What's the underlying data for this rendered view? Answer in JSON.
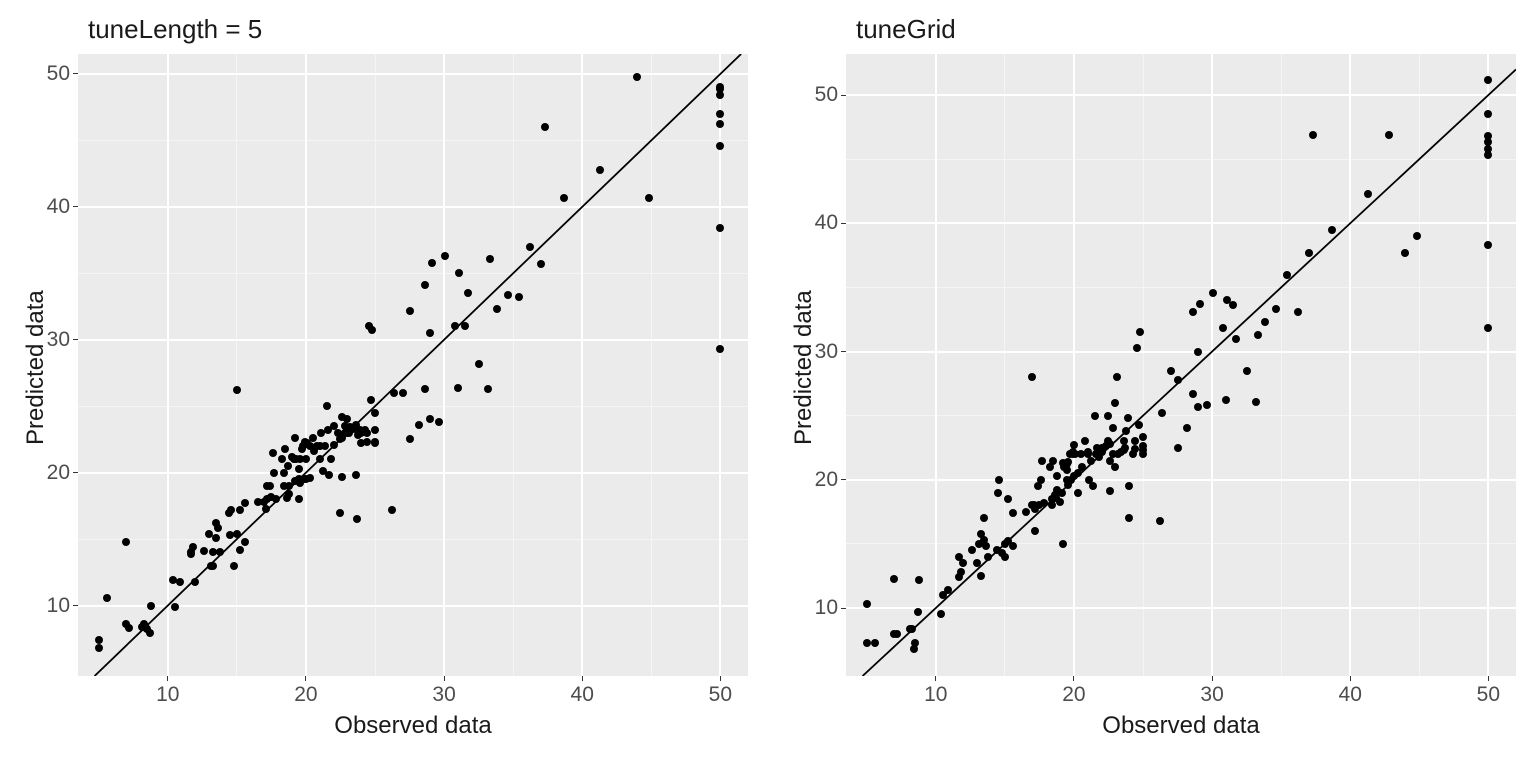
{
  "chart_data": [
    {
      "type": "scatter",
      "title": "tuneLength = 5",
      "xlabel": "Observed data",
      "ylabel": "Predicted data",
      "xlim": [
        3.5,
        52
      ],
      "ylim": [
        4.7,
        51.5
      ],
      "x_ticks": [
        10,
        20,
        30,
        40,
        50
      ],
      "y_ticks": [
        10,
        20,
        30,
        40,
        50
      ],
      "ref_line": {
        "slope": 1,
        "intercept": 0
      },
      "points": [
        [
          5.0,
          7.4
        ],
        [
          5.0,
          6.8
        ],
        [
          5.6,
          10.6
        ],
        [
          7.0,
          8.6
        ],
        [
          7.0,
          14.8
        ],
        [
          7.2,
          8.3
        ],
        [
          8.1,
          8.4
        ],
        [
          8.3,
          8.6
        ],
        [
          8.4,
          8.3
        ],
        [
          8.5,
          8.2
        ],
        [
          8.7,
          7.9
        ],
        [
          8.8,
          10.0
        ],
        [
          10.4,
          11.9
        ],
        [
          10.5,
          9.9
        ],
        [
          10.9,
          11.8
        ],
        [
          11.7,
          13.9
        ],
        [
          11.7,
          14.0
        ],
        [
          11.8,
          14.4
        ],
        [
          12.0,
          11.8
        ],
        [
          12.6,
          14.1
        ],
        [
          13.0,
          15.4
        ],
        [
          13.1,
          13.0
        ],
        [
          13.3,
          13.0
        ],
        [
          13.3,
          14.0
        ],
        [
          13.5,
          15.1
        ],
        [
          13.5,
          16.2
        ],
        [
          13.6,
          15.8
        ],
        [
          13.8,
          14.0
        ],
        [
          14.4,
          17.0
        ],
        [
          14.5,
          15.3
        ],
        [
          14.6,
          17.2
        ],
        [
          14.8,
          13.0
        ],
        [
          15.0,
          26.2
        ],
        [
          15.0,
          15.4
        ],
        [
          15.2,
          14.2
        ],
        [
          15.2,
          17.2
        ],
        [
          15.6,
          14.8
        ],
        [
          15.6,
          17.7
        ],
        [
          16.5,
          17.8
        ],
        [
          17.0,
          17.8
        ],
        [
          17.1,
          17.3
        ],
        [
          17.2,
          19.0
        ],
        [
          17.2,
          18.0
        ],
        [
          17.4,
          19.0
        ],
        [
          17.5,
          18.2
        ],
        [
          17.6,
          21.5
        ],
        [
          17.7,
          20.0
        ],
        [
          17.8,
          18.0
        ],
        [
          18.3,
          21.0
        ],
        [
          18.4,
          19.0
        ],
        [
          18.4,
          20.0
        ],
        [
          18.5,
          21.8
        ],
        [
          18.6,
          18.1
        ],
        [
          18.7,
          20.5
        ],
        [
          18.8,
          18.4
        ],
        [
          18.8,
          19.0
        ],
        [
          19.0,
          21.2
        ],
        [
          19.1,
          21.0
        ],
        [
          19.2,
          22.6
        ],
        [
          19.2,
          19.4
        ],
        [
          19.3,
          21.0
        ],
        [
          19.5,
          20.3
        ],
        [
          19.5,
          19.5
        ],
        [
          19.5,
          18.0
        ],
        [
          19.6,
          19.2
        ],
        [
          19.6,
          21.0
        ],
        [
          19.7,
          21.8
        ],
        [
          19.8,
          22.0
        ],
        [
          19.9,
          19.5
        ],
        [
          19.9,
          22.3
        ],
        [
          20.0,
          19.5
        ],
        [
          20.0,
          21.0
        ],
        [
          20.1,
          22.2
        ],
        [
          20.3,
          22.0
        ],
        [
          20.3,
          19.6
        ],
        [
          20.5,
          22.6
        ],
        [
          20.6,
          21.6
        ],
        [
          20.8,
          22.0
        ],
        [
          21.0,
          22.0
        ],
        [
          21.0,
          21.0
        ],
        [
          21.1,
          23.0
        ],
        [
          21.2,
          20.1
        ],
        [
          21.4,
          22.0
        ],
        [
          21.5,
          25.0
        ],
        [
          21.6,
          23.2
        ],
        [
          21.7,
          19.8
        ],
        [
          21.8,
          21.0
        ],
        [
          22.0,
          22.1
        ],
        [
          22.0,
          23.5
        ],
        [
          22.3,
          23.0
        ],
        [
          22.5,
          17.0
        ],
        [
          22.5,
          22.5
        ],
        [
          22.6,
          19.7
        ],
        [
          22.6,
          22.6
        ],
        [
          22.6,
          24.2
        ],
        [
          22.8,
          23.0
        ],
        [
          22.8,
          23.5
        ],
        [
          23.0,
          24.0
        ],
        [
          23.0,
          23.0
        ],
        [
          23.1,
          23.0
        ],
        [
          23.2,
          23.4
        ],
        [
          23.4,
          23.3
        ],
        [
          23.6,
          23.6
        ],
        [
          23.6,
          19.8
        ],
        [
          23.7,
          16.5
        ],
        [
          23.8,
          22.8
        ],
        [
          23.9,
          23.2
        ],
        [
          24.0,
          22.2
        ],
        [
          24.0,
          23.0
        ],
        [
          24.3,
          23.2
        ],
        [
          24.4,
          23.0
        ],
        [
          24.4,
          22.3
        ],
        [
          24.6,
          31.0
        ],
        [
          24.7,
          25.5
        ],
        [
          24.8,
          30.7
        ],
        [
          25.0,
          23.2
        ],
        [
          25.0,
          22.2
        ],
        [
          25.0,
          22.3
        ],
        [
          25.0,
          24.5
        ],
        [
          26.2,
          17.2
        ],
        [
          26.4,
          26.0
        ],
        [
          27.0,
          26.0
        ],
        [
          27.5,
          32.2
        ],
        [
          27.5,
          22.5
        ],
        [
          28.2,
          23.6
        ],
        [
          28.6,
          26.3
        ],
        [
          28.6,
          34.1
        ],
        [
          29.0,
          24.0
        ],
        [
          29.0,
          30.5
        ],
        [
          29.1,
          35.8
        ],
        [
          29.6,
          23.8
        ],
        [
          30.1,
          36.3
        ],
        [
          30.8,
          31.0
        ],
        [
          31.0,
          26.4
        ],
        [
          31.1,
          35.0
        ],
        [
          31.5,
          31.0
        ],
        [
          31.7,
          33.5
        ],
        [
          32.5,
          28.2
        ],
        [
          33.2,
          26.3
        ],
        [
          33.3,
          36.1
        ],
        [
          33.8,
          32.3
        ],
        [
          34.6,
          33.4
        ],
        [
          35.4,
          33.2
        ],
        [
          36.2,
          37.0
        ],
        [
          37.0,
          35.7
        ],
        [
          37.3,
          46.0
        ],
        [
          38.7,
          40.7
        ],
        [
          41.3,
          42.8
        ],
        [
          44.0,
          49.8
        ],
        [
          44.8,
          40.7
        ],
        [
          50.0,
          47.0
        ],
        [
          50.0,
          38.4
        ],
        [
          50.0,
          46.2
        ],
        [
          50.0,
          48.4
        ],
        [
          50.0,
          49.0
        ],
        [
          50.0,
          48.9
        ],
        [
          50.0,
          29.3
        ],
        [
          50.0,
          44.6
        ]
      ]
    },
    {
      "type": "scatter",
      "title": "tuneGrid",
      "xlabel": "Observed data",
      "ylabel": "Predicted data",
      "xlim": [
        3.5,
        52
      ],
      "ylim": [
        4.7,
        53.2
      ],
      "x_ticks": [
        10,
        20,
        30,
        40,
        50
      ],
      "y_ticks": [
        10,
        20,
        30,
        40,
        50
      ],
      "ref_line": {
        "slope": 1,
        "intercept": 0
      },
      "points": [
        [
          5.0,
          10.3
        ],
        [
          5.0,
          7.3
        ],
        [
          5.6,
          7.3
        ],
        [
          7.0,
          12.3
        ],
        [
          7.0,
          8.0
        ],
        [
          7.2,
          8.0
        ],
        [
          8.1,
          8.4
        ],
        [
          8.3,
          8.4
        ],
        [
          8.4,
          6.8
        ],
        [
          8.5,
          7.3
        ],
        [
          8.7,
          9.7
        ],
        [
          8.8,
          12.2
        ],
        [
          10.4,
          9.5
        ],
        [
          10.5,
          11.0
        ],
        [
          10.9,
          11.4
        ],
        [
          11.7,
          14.0
        ],
        [
          11.7,
          12.4
        ],
        [
          11.8,
          12.8
        ],
        [
          12.0,
          13.5
        ],
        [
          12.6,
          14.5
        ],
        [
          13.0,
          13.5
        ],
        [
          13.1,
          15.0
        ],
        [
          13.3,
          12.5
        ],
        [
          13.3,
          15.8
        ],
        [
          13.5,
          15.3
        ],
        [
          13.5,
          17.0
        ],
        [
          13.6,
          14.8
        ],
        [
          13.8,
          14.0
        ],
        [
          14.4,
          14.5
        ],
        [
          14.5,
          19.0
        ],
        [
          14.6,
          20.0
        ],
        [
          14.8,
          14.3
        ],
        [
          15.0,
          15.0
        ],
        [
          15.0,
          14.0
        ],
        [
          15.2,
          18.5
        ],
        [
          15.2,
          15.2
        ],
        [
          15.6,
          14.8
        ],
        [
          15.6,
          17.4
        ],
        [
          16.5,
          17.5
        ],
        [
          17.0,
          18.0
        ],
        [
          17.0,
          28.0
        ],
        [
          17.1,
          18.0
        ],
        [
          17.2,
          16.0
        ],
        [
          17.2,
          17.7
        ],
        [
          17.4,
          19.5
        ],
        [
          17.5,
          18.0
        ],
        [
          17.6,
          20.0
        ],
        [
          17.7,
          21.5
        ],
        [
          17.8,
          18.2
        ],
        [
          18.3,
          21.0
        ],
        [
          18.4,
          18.0
        ],
        [
          18.4,
          18.5
        ],
        [
          18.5,
          21.5
        ],
        [
          18.6,
          18.8
        ],
        [
          18.7,
          18.6
        ],
        [
          18.8,
          19.2
        ],
        [
          18.8,
          20.3
        ],
        [
          19.0,
          18.3
        ],
        [
          19.1,
          19.0
        ],
        [
          19.2,
          21.3
        ],
        [
          19.2,
          15.0
        ],
        [
          19.3,
          21.0
        ],
        [
          19.5,
          20.8
        ],
        [
          19.5,
          20.0
        ],
        [
          19.5,
          21.2
        ],
        [
          19.6,
          19.6
        ],
        [
          19.6,
          21.4
        ],
        [
          19.7,
          22.0
        ],
        [
          19.8,
          20.0
        ],
        [
          19.9,
          22.0
        ],
        [
          19.9,
          22.2
        ],
        [
          20.0,
          22.7
        ],
        [
          20.0,
          20.3
        ],
        [
          20.1,
          22.0
        ],
        [
          20.3,
          20.5
        ],
        [
          20.3,
          19.0
        ],
        [
          20.5,
          22.0
        ],
        [
          20.6,
          21.0
        ],
        [
          20.8,
          23.0
        ],
        [
          21.0,
          22.0
        ],
        [
          21.0,
          22.2
        ],
        [
          21.1,
          20.0
        ],
        [
          21.2,
          21.5
        ],
        [
          21.4,
          19.5
        ],
        [
          21.5,
          25.0
        ],
        [
          21.6,
          22.0
        ],
        [
          21.7,
          22.5
        ],
        [
          21.8,
          21.8
        ],
        [
          22.0,
          22.2
        ],
        [
          22.0,
          22.5
        ],
        [
          22.3,
          22.6
        ],
        [
          22.5,
          23.0
        ],
        [
          22.5,
          25.0
        ],
        [
          22.6,
          19.1
        ],
        [
          22.6,
          21.5
        ],
        [
          22.6,
          22.8
        ],
        [
          22.8,
          24.0
        ],
        [
          22.8,
          22.0
        ],
        [
          23.0,
          26.0
        ],
        [
          23.0,
          21.0
        ],
        [
          23.1,
          28.0
        ],
        [
          23.2,
          22.0
        ],
        [
          23.4,
          22.2
        ],
        [
          23.6,
          23.0
        ],
        [
          23.6,
          22.3
        ],
        [
          23.7,
          22.5
        ],
        [
          23.8,
          23.8
        ],
        [
          23.9,
          24.8
        ],
        [
          24.0,
          19.5
        ],
        [
          24.0,
          17.0
        ],
        [
          24.3,
          22.0
        ],
        [
          24.4,
          22.4
        ],
        [
          24.4,
          23.0
        ],
        [
          24.6,
          30.3
        ],
        [
          24.7,
          24.3
        ],
        [
          24.8,
          31.5
        ],
        [
          25.0,
          22.3
        ],
        [
          25.0,
          23.3
        ],
        [
          25.0,
          22.0
        ],
        [
          25.0,
          22.6
        ],
        [
          26.2,
          16.8
        ],
        [
          26.4,
          25.2
        ],
        [
          27.0,
          28.5
        ],
        [
          27.5,
          22.5
        ],
        [
          27.5,
          27.8
        ],
        [
          28.2,
          24.0
        ],
        [
          28.6,
          26.7
        ],
        [
          28.6,
          33.1
        ],
        [
          29.0,
          30.0
        ],
        [
          29.0,
          25.7
        ],
        [
          29.1,
          33.7
        ],
        [
          29.6,
          25.8
        ],
        [
          30.1,
          34.6
        ],
        [
          30.8,
          31.8
        ],
        [
          31.0,
          26.2
        ],
        [
          31.1,
          34.0
        ],
        [
          31.5,
          33.6
        ],
        [
          31.7,
          31.0
        ],
        [
          32.5,
          28.5
        ],
        [
          33.2,
          26.1
        ],
        [
          33.3,
          31.3
        ],
        [
          33.8,
          32.3
        ],
        [
          34.6,
          33.3
        ],
        [
          35.4,
          36.0
        ],
        [
          36.2,
          33.1
        ],
        [
          37.0,
          37.7
        ],
        [
          37.3,
          46.9
        ],
        [
          38.7,
          39.5
        ],
        [
          41.3,
          42.3
        ],
        [
          42.8,
          46.9
        ],
        [
          44.0,
          37.7
        ],
        [
          44.8,
          39.0
        ],
        [
          50.0,
          45.3
        ],
        [
          50.0,
          38.3
        ],
        [
          50.0,
          46.3
        ],
        [
          50.0,
          48.5
        ],
        [
          50.0,
          45.8
        ],
        [
          50.0,
          46.8
        ],
        [
          50.0,
          51.2
        ],
        [
          50.0,
          31.8
        ]
      ]
    }
  ]
}
